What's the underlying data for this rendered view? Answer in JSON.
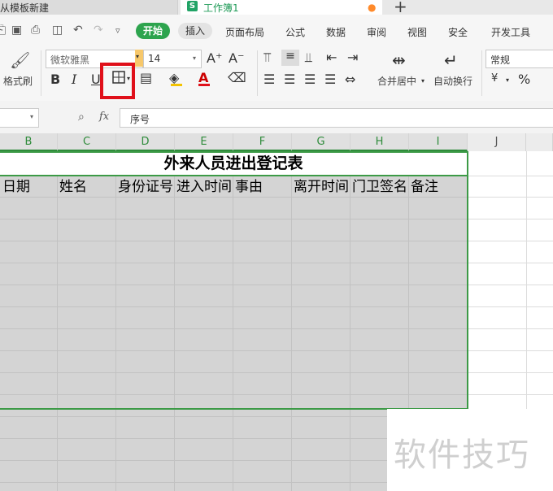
{
  "tabs": {
    "template_tab": "从模板新建",
    "workbook_tab": "工作簿1",
    "workbook_icon": "S",
    "new_tab": "+"
  },
  "menu": {
    "items": [
      "开始",
      "插入",
      "页面布局",
      "公式",
      "数据",
      "审阅",
      "视图",
      "安全",
      "开发工具"
    ]
  },
  "ribbon": {
    "format_painter": "格式刷",
    "font_name": "微软雅黑",
    "font_size": "14",
    "grow_font": "A⁺",
    "shrink_font": "A⁻",
    "bold": "B",
    "italic": "I",
    "underline": "U",
    "merge_center": "合并居中",
    "wrap_text": "自动换行",
    "number_format": "常规",
    "currency": "¥",
    "percent": "%",
    "accent_color": "#2da44e",
    "highlight_color": "#e0101a"
  },
  "formula_bar": {
    "fx": "fx",
    "content": "序号"
  },
  "sheet": {
    "columns": [
      "B",
      "C",
      "D",
      "E",
      "F",
      "G",
      "H",
      "I",
      "J"
    ],
    "title": "外来人员进出登记表",
    "headers": [
      "日期",
      "姓名",
      "身份证号",
      "进入时间",
      "事由",
      "离开时间",
      "门卫签名",
      "备注"
    ]
  },
  "watermark": "软件技巧"
}
